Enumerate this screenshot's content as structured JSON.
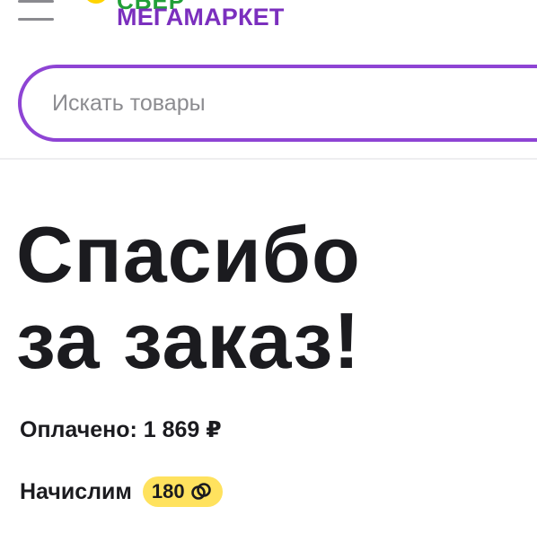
{
  "header": {
    "logo_top": "СБЕР",
    "logo_main": "МЕГАМАРКЕТ"
  },
  "search": {
    "placeholder": "Искать товары"
  },
  "main": {
    "title_line1": "Спасибо",
    "title_line2": "за заказ!",
    "paid_text": "Оплачено: 1 869 ₽",
    "bonus_label": "Начислим",
    "bonus_value": "180"
  },
  "colors": {
    "brand_purple": "#7b2fbe",
    "search_border": "#8e44d4",
    "brand_green": "#21a038",
    "badge_yellow": "#ffe25e"
  },
  "icons": {
    "menu": "hamburger-menu-icon",
    "bonus": "bonus-coins-icon",
    "logo": "sber-logo-icon"
  }
}
